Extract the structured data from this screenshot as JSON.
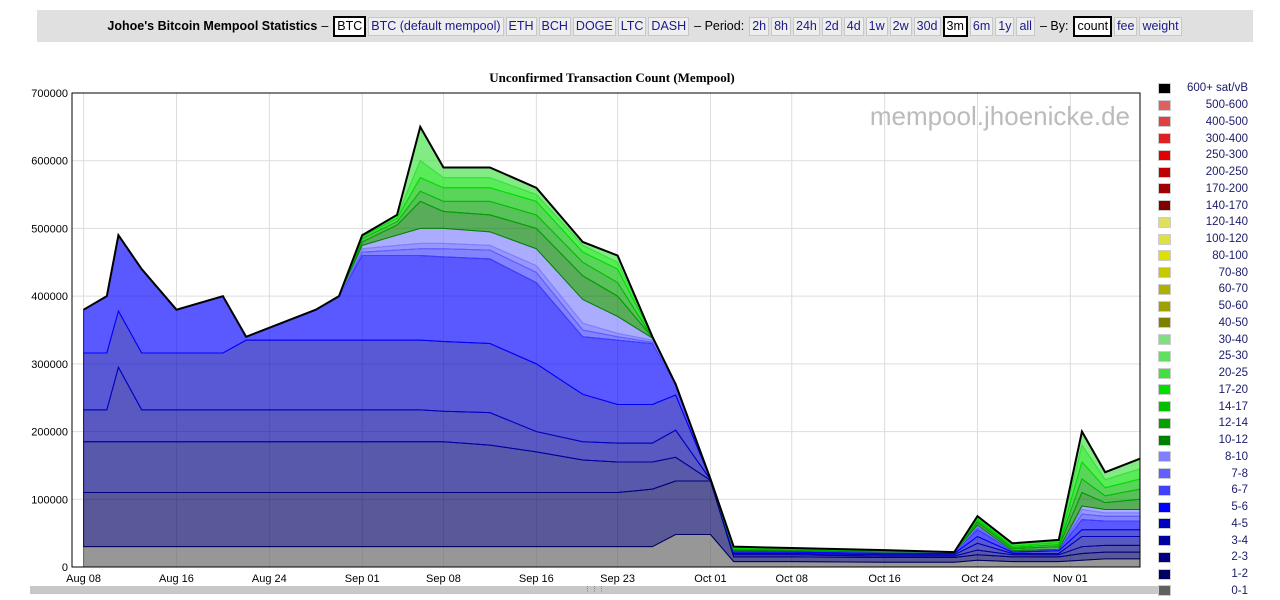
{
  "header": {
    "title": "Johoe's Bitcoin Mempool Statistics",
    "dash": "–",
    "coins": [
      {
        "label": "BTC",
        "selected": true
      },
      {
        "label": "BTC (default mempool)"
      },
      {
        "label": "ETH"
      },
      {
        "label": "BCH"
      },
      {
        "label": "DOGE"
      },
      {
        "label": "LTC"
      },
      {
        "label": "DASH"
      }
    ],
    "period_label": "– Period:",
    "periods": [
      {
        "label": "2h"
      },
      {
        "label": "8h"
      },
      {
        "label": "24h"
      },
      {
        "label": "2d"
      },
      {
        "label": "4d"
      },
      {
        "label": "1w"
      },
      {
        "label": "2w"
      },
      {
        "label": "30d"
      },
      {
        "label": "3m",
        "selected": true
      },
      {
        "label": "6m"
      },
      {
        "label": "1y"
      },
      {
        "label": "all"
      }
    ],
    "by_label": "– By:",
    "by": [
      {
        "label": "count",
        "selected": true
      },
      {
        "label": "fee"
      },
      {
        "label": "weight"
      }
    ]
  },
  "watermark": "mempool.jhoenicke.de",
  "chart_data": {
    "type": "area",
    "stacked": true,
    "title": "Unconfirmed Transaction Count (Mempool)",
    "xlabel": "",
    "ylabel": "",
    "ylim": [
      0,
      700000
    ],
    "xlim": [
      "Aug 07",
      "Nov 07"
    ],
    "grid": true,
    "legend_placement": "right",
    "yticks": [
      0,
      100000,
      200000,
      300000,
      400000,
      500000,
      600000,
      700000
    ],
    "xticks": [
      "Aug 08",
      "Aug 16",
      "Aug 24",
      "Sep 01",
      "Sep 08",
      "Sep 16",
      "Sep 23",
      "Oct 01",
      "Oct 08",
      "Oct 16",
      "Oct 24",
      "Nov 01"
    ],
    "x": [
      "Aug 08",
      "Aug 10",
      "Aug 11",
      "Aug 13",
      "Aug 16",
      "Aug 20",
      "Aug 22",
      "Aug 28",
      "Aug 30",
      "Sep 01",
      "Sep 04",
      "Sep 06",
      "Sep 08",
      "Sep 12",
      "Sep 16",
      "Sep 20",
      "Sep 23",
      "Sep 26",
      "Sep 28",
      "Oct 01",
      "Oct 03",
      "Oct 08",
      "Oct 16",
      "Oct 22",
      "Oct 24",
      "Oct 27",
      "Oct 31",
      "Nov 02",
      "Nov 04",
      "Nov 07"
    ],
    "legend": [
      {
        "name": "600+ sat/vB",
        "color": "#000000"
      },
      {
        "name": "500-600",
        "color": "#e06060"
      },
      {
        "name": "400-500",
        "color": "#e04040"
      },
      {
        "name": "300-400",
        "color": "#e02020"
      },
      {
        "name": "250-300",
        "color": "#e00000"
      },
      {
        "name": "200-250",
        "color": "#c00000"
      },
      {
        "name": "170-200",
        "color": "#a00000"
      },
      {
        "name": "140-170",
        "color": "#800000"
      },
      {
        "name": "120-140",
        "color": "#e0e060"
      },
      {
        "name": "100-120",
        "color": "#e0e040"
      },
      {
        "name": "80-100",
        "color": "#e0e000"
      },
      {
        "name": "70-80",
        "color": "#c8c800"
      },
      {
        "name": "60-70",
        "color": "#b0b000"
      },
      {
        "name": "50-60",
        "color": "#a0a000"
      },
      {
        "name": "40-50",
        "color": "#808000"
      },
      {
        "name": "30-40",
        "color": "#80e080"
      },
      {
        "name": "25-30",
        "color": "#60e060"
      },
      {
        "name": "20-25",
        "color": "#40e040"
      },
      {
        "name": "17-20",
        "color": "#00e000"
      },
      {
        "name": "14-17",
        "color": "#00c000"
      },
      {
        "name": "12-14",
        "color": "#00a000"
      },
      {
        "name": "10-12",
        "color": "#008000"
      },
      {
        "name": "8-10",
        "color": "#8080ff"
      },
      {
        "name": "7-8",
        "color": "#6060ff"
      },
      {
        "name": "6-7",
        "color": "#4040ff"
      },
      {
        "name": "5-6",
        "color": "#0000ff"
      },
      {
        "name": "4-5",
        "color": "#0000c0"
      },
      {
        "name": "3-4",
        "color": "#0000a0"
      },
      {
        "name": "2-3",
        "color": "#000080"
      },
      {
        "name": "1-2",
        "color": "#000060"
      },
      {
        "name": "0-1",
        "color": "#606060"
      }
    ],
    "series": [
      {
        "name": "0-1",
        "color": "#606060",
        "values": [
          30000,
          30000,
          30000,
          30000,
          30000,
          30000,
          30000,
          30000,
          30000,
          30000,
          30000,
          30000,
          30000,
          30000,
          30000,
          30000,
          30000,
          30000,
          48000,
          48000,
          8000,
          8000,
          7000,
          7000,
          10000,
          8000,
          8000,
          10000,
          12000,
          12000
        ]
      },
      {
        "name": "1-2",
        "color": "#000060",
        "values": [
          80000,
          80000,
          80000,
          80000,
          80000,
          80000,
          80000,
          80000,
          80000,
          80000,
          80000,
          80000,
          80000,
          80000,
          80000,
          80000,
          80000,
          85000,
          79000,
          79000,
          7000,
          7000,
          7000,
          7000,
          8000,
          7000,
          7000,
          10000,
          10000,
          10000
        ]
      },
      {
        "name": "2-3",
        "color": "#000080",
        "values": [
          75000,
          75000,
          75000,
          75000,
          75000,
          75000,
          75000,
          75000,
          75000,
          75000,
          75000,
          75000,
          75000,
          70000,
          60000,
          48000,
          45000,
          40000,
          35000,
          1000,
          3000,
          3000,
          2000,
          2000,
          7000,
          3000,
          3000,
          10000,
          10000,
          10000
        ]
      },
      {
        "name": "3-4",
        "color": "#0000a0",
        "values": [
          47000,
          47000,
          110000,
          47000,
          47000,
          47000,
          47000,
          47000,
          47000,
          47000,
          47000,
          47000,
          45000,
          48000,
          30000,
          27000,
          28000,
          28000,
          40000,
          1000,
          2000,
          2000,
          2000,
          2000,
          10000,
          2000,
          2000,
          15000,
          13000,
          13000
        ]
      },
      {
        "name": "4-5",
        "color": "#0000c0",
        "values": [
          84000,
          84000,
          83000,
          84000,
          84000,
          84000,
          103000,
          103000,
          103000,
          103000,
          103000,
          103000,
          103000,
          102000,
          100000,
          70000,
          57000,
          57000,
          52000,
          1000,
          2000,
          2000,
          2000,
          2000,
          10000,
          2000,
          4000,
          10000,
          10000,
          10000
        ]
      },
      {
        "name": "5-6",
        "color": "#0000ff",
        "values": [
          64000,
          84000,
          112000,
          124000,
          64000,
          84000,
          5000,
          45000,
          65000,
          125000,
          125000,
          125000,
          125000,
          125000,
          120000,
          85000,
          95000,
          90000,
          16000,
          0,
          2000,
          2000,
          2000,
          2000,
          10000,
          2000,
          2000,
          15000,
          13000,
          13000
        ]
      },
      {
        "name": "6-7",
        "color": "#4040ff",
        "values": [
          0,
          0,
          0,
          0,
          0,
          0,
          0,
          0,
          0,
          5000,
          8000,
          10000,
          12000,
          13000,
          15000,
          10000,
          5000,
          2000,
          0,
          0,
          0,
          0,
          0,
          0,
          3000,
          0,
          0,
          8000,
          7000,
          7000
        ]
      },
      {
        "name": "7-8",
        "color": "#6060ff",
        "values": [
          0,
          0,
          0,
          0,
          0,
          0,
          0,
          0,
          0,
          5000,
          7000,
          8000,
          8000,
          7000,
          10000,
          10000,
          5000,
          3000,
          0,
          0,
          0,
          0,
          0,
          0,
          2000,
          0,
          0,
          7000,
          5000,
          5000
        ]
      },
      {
        "name": "8-10",
        "color": "#8080ff",
        "values": [
          0,
          0,
          0,
          0,
          0,
          0,
          0,
          0,
          0,
          5000,
          15000,
          22000,
          22000,
          20000,
          25000,
          35000,
          25000,
          3000,
          0,
          0,
          0,
          0,
          0,
          0,
          2000,
          0,
          0,
          5000,
          5000,
          5000
        ]
      },
      {
        "name": "10-12",
        "color": "#008000",
        "values": [
          0,
          0,
          0,
          0,
          0,
          0,
          0,
          0,
          0,
          5000,
          15000,
          40000,
          25000,
          25000,
          30000,
          35000,
          30000,
          1000,
          0,
          0,
          2000,
          1000,
          1000,
          0,
          4000,
          3000,
          4000,
          20000,
          10000,
          15000
        ]
      },
      {
        "name": "12-14",
        "color": "#00a000",
        "values": [
          0,
          0,
          0,
          0,
          0,
          0,
          0,
          0,
          0,
          5000,
          5000,
          15000,
          15000,
          20000,
          20000,
          20000,
          20000,
          0,
          0,
          0,
          1000,
          1000,
          1000,
          0,
          3000,
          2000,
          3000,
          20000,
          10000,
          15000
        ]
      },
      {
        "name": "14-17",
        "color": "#00c000",
        "values": [
          0,
          0,
          0,
          0,
          0,
          0,
          0,
          0,
          0,
          3000,
          5000,
          20000,
          20000,
          20000,
          20000,
          15000,
          20000,
          1000,
          0,
          0,
          1000,
          1000,
          1000,
          0,
          2000,
          2000,
          3000,
          25000,
          12000,
          15000
        ]
      },
      {
        "name": "17-20",
        "color": "#00e000",
        "values": [
          0,
          0,
          0,
          0,
          0,
          0,
          0,
          0,
          0,
          2000,
          3000,
          25000,
          15000,
          15000,
          10000,
          10000,
          10000,
          0,
          0,
          0,
          1000,
          1000,
          0,
          0,
          2000,
          2000,
          2000,
          25000,
          12000,
          15000
        ]
      },
      {
        "name": "20-25",
        "color": "#40e040",
        "values": [
          0,
          0,
          0,
          0,
          0,
          0,
          0,
          0,
          0,
          0,
          2000,
          50000,
          15000,
          15000,
          10000,
          5000,
          10000,
          0,
          0,
          0,
          1000,
          0,
          0,
          0,
          2000,
          2000,
          2000,
          20000,
          11000,
          15000
        ]
      }
    ]
  }
}
